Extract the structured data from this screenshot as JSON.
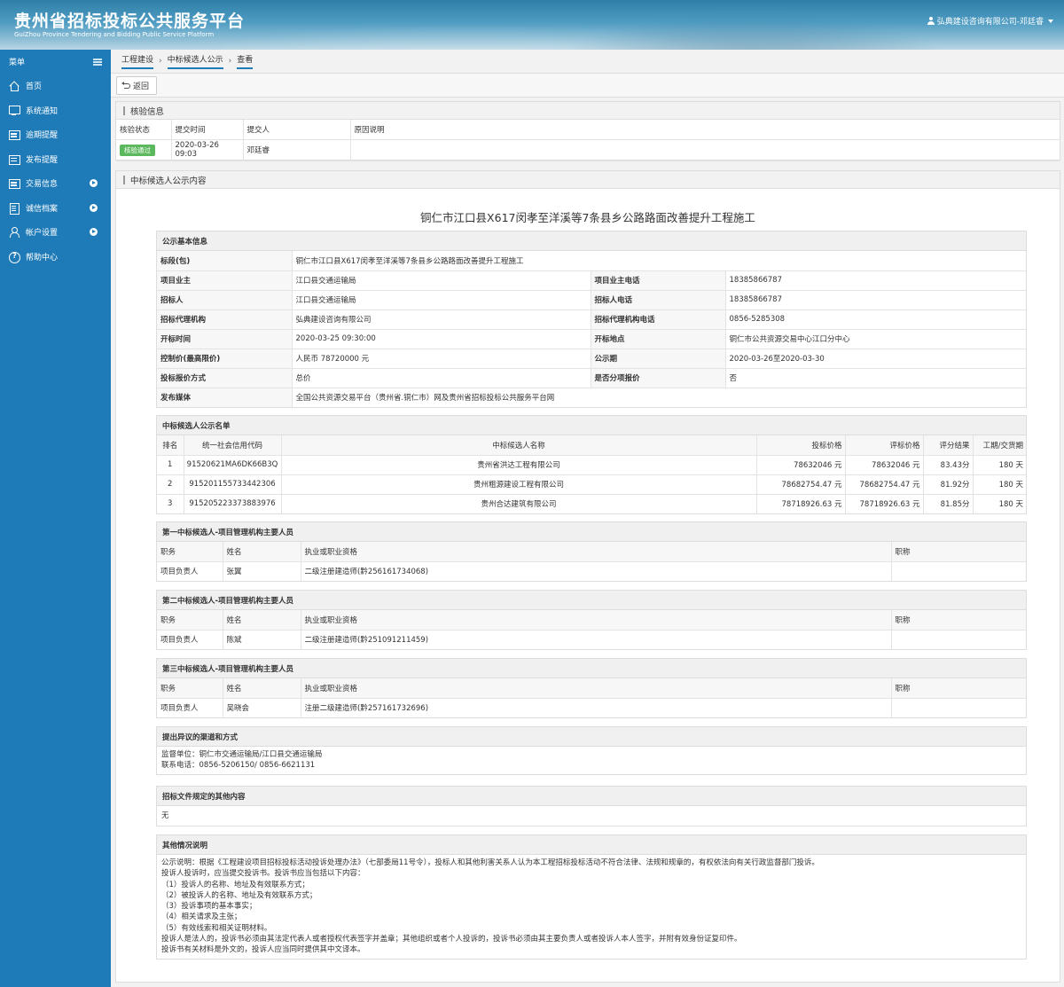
{
  "header": {
    "title": "贵州省招标投标公共服务平台",
    "subtitle": "GuiZhou Province Tendering and Bidding Public Service Platform",
    "user": "弘典建设咨询有限公司-邓廷睿"
  },
  "sidebar": {
    "menu_label": "菜单",
    "items": [
      {
        "label": "首页"
      },
      {
        "label": "系统通知"
      },
      {
        "label": "逾期提醒"
      },
      {
        "label": "发布提醒"
      },
      {
        "label": "交易信息"
      },
      {
        "label": "诚信档案"
      },
      {
        "label": "帐户设置"
      },
      {
        "label": "帮助中心"
      }
    ]
  },
  "breadcrumb": [
    "工程建设",
    "中标候选人公示",
    "查看"
  ],
  "back_label": "返回",
  "verify": {
    "title": "核验信息",
    "headers": [
      "核验状态",
      "提交时间",
      "提交人",
      "原因说明"
    ],
    "status": "核验通过",
    "time": "2020-03-26 09:03",
    "person": "邓廷睿",
    "reason": ""
  },
  "notice": {
    "panel_title": "中标候选人公示内容",
    "title": "铜仁市江口县X617闵孝至洋溪等7条县乡公路路面改善提升工程施工",
    "basic": {
      "title": "公示基本信息",
      "section_label": "标段(包)",
      "section": "铜仁市江口县X617闵孝至洋溪等7条县乡公路路面改善提升工程施工",
      "owner_label": "项目业主",
      "owner": "江口县交通运输局",
      "owner_tel_label": "项目业主电话",
      "owner_tel": "18385866787",
      "tenderer_label": "招标人",
      "tenderer": "江口县交通运输局",
      "tenderer_tel_label": "招标人电话",
      "tenderer_tel": "18385866787",
      "agency_label": "招标代理机构",
      "agency": "弘典建设咨询有限公司",
      "agency_tel_label": "招标代理机构电话",
      "agency_tel": "0856-5285308",
      "open_time_label": "开标时间",
      "open_time": "2020-03-25 09:30:00",
      "open_place_label": "开标地点",
      "open_place": "铜仁市公共资源交易中心江口分中心",
      "price_cap_label": "控制价(最高限价)",
      "price_cap": "人民币 78720000 元",
      "period_label": "公示期",
      "period": "2020-03-26至2020-03-30",
      "quote_label": "投标报价方式",
      "quote": "总价",
      "split_label": "是否分项报价",
      "split": "否",
      "media_label": "发布媒体",
      "media": "全国公共资源交易平台（贵州省.铜仁市）网及贵州省招标投标公共服务平台网"
    },
    "candidates": {
      "title": "中标候选人公示名单",
      "headers": [
        "排名",
        "统一社会信用代码",
        "中标候选人名称",
        "投标价格",
        "评标价格",
        "评分结果",
        "工期/交货期"
      ],
      "rows": [
        {
          "rank": "1",
          "code": "91520621MA6DK66B3Q",
          "name": "贵州省洪达工程有限公司",
          "bid": "78632046 元",
          "eval": "78632046 元",
          "score": "83.43分",
          "period": "180 天"
        },
        {
          "rank": "2",
          "code": "915201155733442306",
          "name": "贵州粗源建设工程有限公司",
          "bid": "78682754.47 元",
          "eval": "78682754.47 元",
          "score": "81.92分",
          "period": "180 天"
        },
        {
          "rank": "3",
          "code": "915205223373883976",
          "name": "贵州合达建筑有限公司",
          "bid": "78718926.63 元",
          "eval": "78718926.63 元",
          "score": "81.85分",
          "period": "180 天"
        }
      ]
    },
    "staff_headers": [
      "职务",
      "姓名",
      "执业或职业资格",
      "职称"
    ],
    "staff": [
      {
        "title": "第一中标候选人-项目管理机构主要人员",
        "role": "项目负责人",
        "name": "张翼",
        "cert": "二级注册建造师(黔256161734068)",
        "rank": ""
      },
      {
        "title": "第二中标候选人-项目管理机构主要人员",
        "role": "项目负责人",
        "name": "陈斌",
        "cert": "二级注册建造师(黔251091211459)",
        "rank": ""
      },
      {
        "title": "第三中标候选人-项目管理机构主要人员",
        "role": "项目负责人",
        "name": "吴晓会",
        "cert": "注册二级建造师(黔257161732696)",
        "rank": ""
      }
    ],
    "objection": {
      "title": "提出异议的渠道和方式",
      "lines": [
        "监督单位：铜仁市交通运输局/江口县交通运输局",
        "联系电话：0856-5206150/ 0856-6621131"
      ]
    },
    "other_content": {
      "title": "招标文件规定的其他内容",
      "text": "无"
    },
    "other_notes": {
      "title": "其他情况说明",
      "lines": [
        "公示说明：根据《工程建设项目招标投标活动投诉处理办法》（七部委局11号令），投标人和其他利害关系人认为本工程招标投标活动不符合法律、法规和规章的，有权依法向有关行政监督部门投诉。",
        "投诉人投诉时，应当提交投诉书。投诉书应当包括以下内容：",
        "（1）投诉人的名称、地址及有效联系方式；",
        "（2）被投诉人的名称、地址及有效联系方式；",
        "（3）投诉事项的基本事实；",
        "（4）相关请求及主张；",
        "（5）有效线索和相关证明材料。",
        "投诉人是法人的，投诉书必须由其法定代表人或者授权代表签字并盖章；其他组织或者个人投诉的，投诉书必须由其主要负责人或者投诉人本人签字，并附有效身份证复印件。",
        "投诉书有关材料是外文的，投诉人应当同时提供其中文译本。"
      ]
    }
  }
}
